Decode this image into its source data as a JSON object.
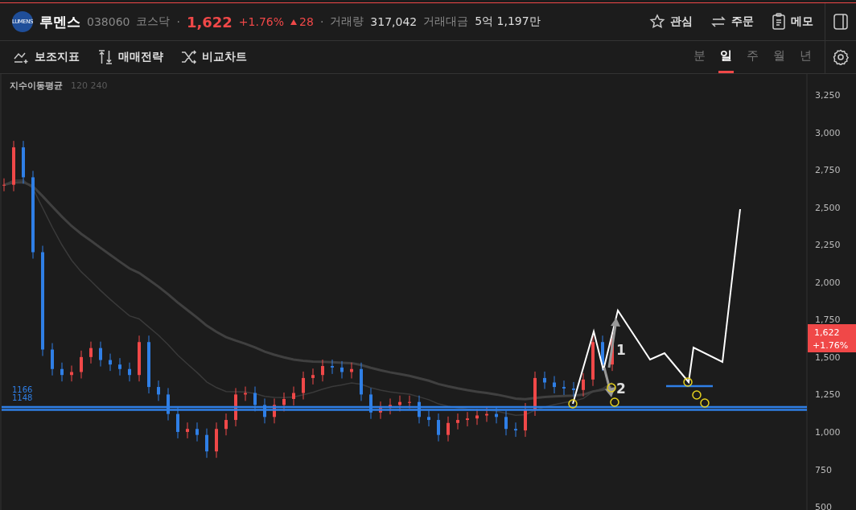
{
  "header": {
    "logo": "LUMENS",
    "name": "루멘스",
    "code": "038060",
    "market": "코스닥",
    "separator": "·",
    "price": "1,622",
    "change_rate": "+1.76%",
    "change": "28",
    "volume_label": "거래량",
    "volume": "317,042",
    "amount_label": "거래대금",
    "amount": "5억 1,197만",
    "actions": [
      {
        "label": "관심"
      },
      {
        "label": "주문"
      },
      {
        "label": "메모"
      }
    ]
  },
  "toolbar": {
    "tools": [
      {
        "label": "보조지표"
      },
      {
        "label": "매매전략"
      },
      {
        "label": "비교차트"
      }
    ],
    "periods": [
      {
        "label": "분",
        "selected": false
      },
      {
        "label": "일",
        "selected": true
      },
      {
        "label": "주",
        "selected": false
      },
      {
        "label": "월",
        "selected": false
      },
      {
        "label": "년",
        "selected": false
      }
    ]
  },
  "chart": {
    "legend": {
      "title": "지수이동평균",
      "params": "120 240"
    },
    "price_tag": {
      "price": "1,622",
      "change": "+1.76%"
    },
    "levels": [
      {
        "label": "1166"
      },
      {
        "label": "1148"
      }
    ],
    "annotations": [
      "1",
      "2"
    ],
    "axis_labels": [
      "3,250",
      "3,000",
      "2,750",
      "2,500",
      "2,250",
      "2,000",
      "1,750",
      "1,500",
      "1,250",
      "1,000",
      "750",
      "500"
    ]
  }
}
